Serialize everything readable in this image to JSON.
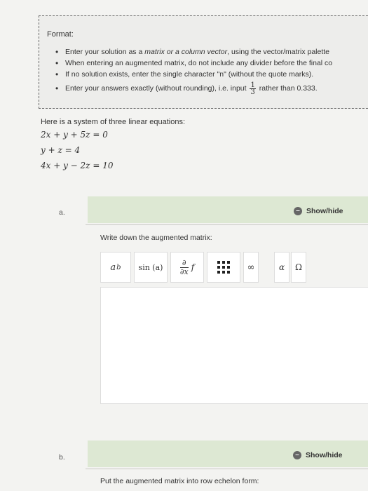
{
  "format": {
    "title": "Format:",
    "items": [
      {
        "pre": "Enter your solution as a ",
        "emph": "matrix or a column vector",
        "post": ", using the vector/matrix palette"
      },
      {
        "text": "When entering an augmented matrix, do not include any divider before the final co"
      },
      {
        "text": "If no solution exists, enter the single character \"n\" (without the quote marks)."
      },
      {
        "pre": "Enter your answers exactly (without rounding), i.e. input ",
        "frac_num": "1",
        "frac_den": "3",
        "post": " rather than 0.333."
      }
    ]
  },
  "problem": {
    "intro": "Here is a system of three linear equations:",
    "equations": [
      "2x + y + 5z = 0",
      "y + z = 4",
      "4x + y − 2z = 10"
    ]
  },
  "part_a": {
    "label": "a.",
    "show_hide": "Show/hide",
    "prompt": "Write down the augmented matrix:",
    "toolbar": {
      "power": {
        "base": "a",
        "exp": "b"
      },
      "sin": "sin (a)",
      "deriv": {
        "num": "∂",
        "den": "∂x",
        "f": "f"
      },
      "infinity": "∞",
      "alpha": "α",
      "omega": "Ω"
    }
  },
  "part_b": {
    "label": "b.",
    "show_hide": "Show/hide",
    "prompt": "Put the augmented matrix into row echelon form:"
  }
}
